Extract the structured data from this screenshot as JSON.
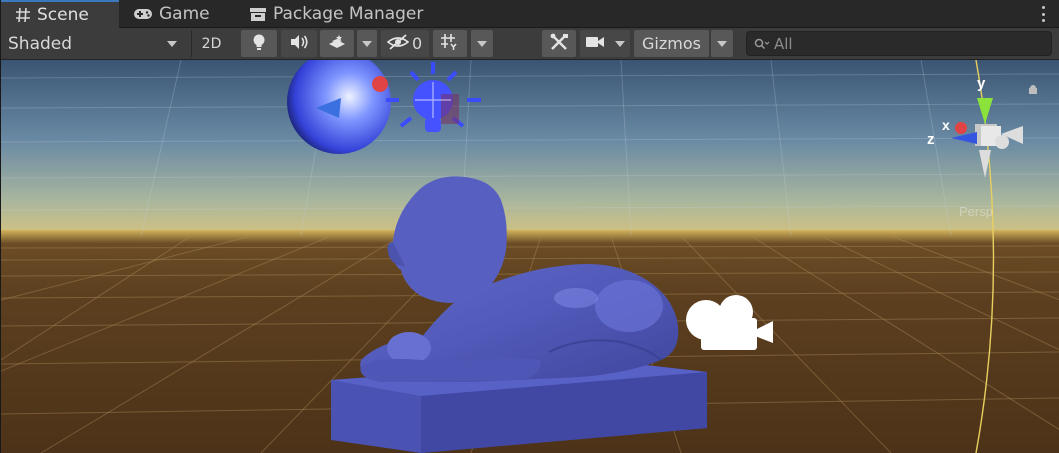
{
  "tabs": [
    {
      "label": "Scene",
      "icon": "hash-grid-icon",
      "active": true
    },
    {
      "label": "Game",
      "icon": "gamepad-icon",
      "active": false
    },
    {
      "label": "Package Manager",
      "icon": "package-icon",
      "active": false
    }
  ],
  "toolbar": {
    "draw_mode": "Shaded",
    "mode_2d": "2D",
    "lighting_icon": "lightbulb-icon",
    "audio_icon": "speaker-icon",
    "effects_icon": "effects-layers-icon",
    "hidden_count": "0",
    "grid_icon": "grid-axis-icon",
    "tools_icon": "tools-icon",
    "camera_icon": "camera-icon",
    "gizmos_label": "Gizmos",
    "search_placeholder": "All"
  },
  "scene": {
    "orientation_gizmo": {
      "labels": {
        "y": "y",
        "x": "x",
        "z": "z"
      },
      "projection": "Persp",
      "lock_icon": "lock-icon"
    },
    "objects": [
      "lion-statue",
      "directional-light",
      "point-light",
      "camera-gizmo"
    ]
  },
  "colors": {
    "accent": "#3a79bb",
    "statue": "#5158b8",
    "ground": "#5a3d1e",
    "sky_top": "#3d5a7a",
    "horizon": "#c9b876"
  }
}
